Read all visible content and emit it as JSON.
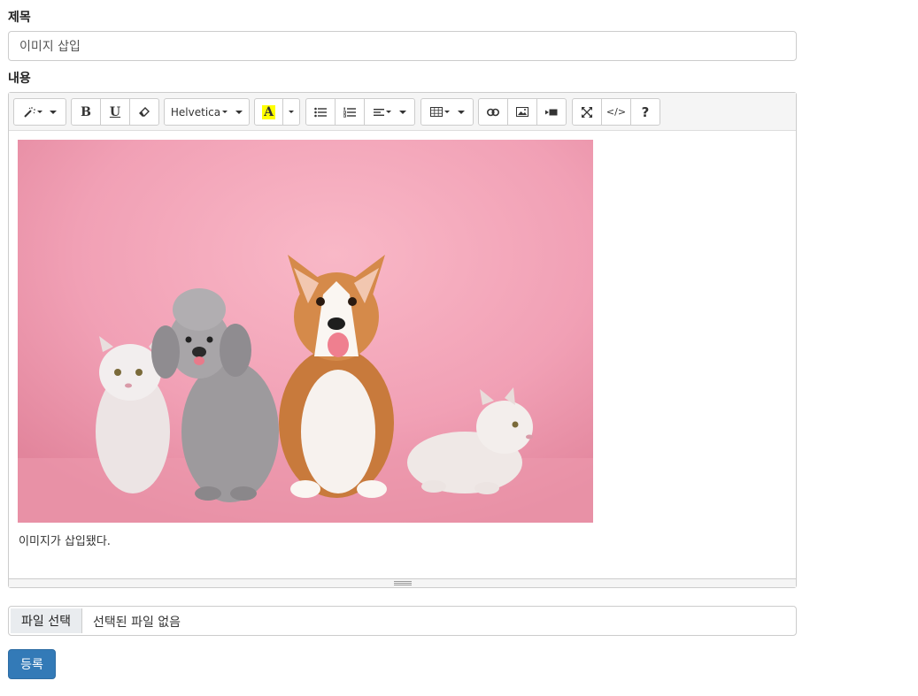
{
  "form": {
    "title_label": "제목",
    "title_value": "이미지 삽입",
    "content_label": "내용",
    "file_button": "파일 선택",
    "file_status": "선택된 파일 없음",
    "submit_label": "등록"
  },
  "toolbar": {
    "font_name": "Helvetica",
    "icons": [
      "magic-icon",
      "bold-icon",
      "underline-icon",
      "eraser-icon",
      "font-color-icon",
      "unordered-list-icon",
      "ordered-list-icon",
      "align-icon",
      "table-icon",
      "link-icon",
      "picture-icon",
      "video-icon",
      "fullscreen-icon",
      "code-view-icon",
      "help-icon"
    ],
    "bold_glyph": "B",
    "underline_glyph": "U",
    "color_glyph": "A",
    "code_glyph": "</>",
    "help_glyph": "?",
    "highlight_color": "#ffff00"
  },
  "editor": {
    "caption": "이미지가 삽입됐다."
  },
  "colors": {
    "primary": "#337ab7",
    "photo_bg": "#f2a2b6"
  }
}
